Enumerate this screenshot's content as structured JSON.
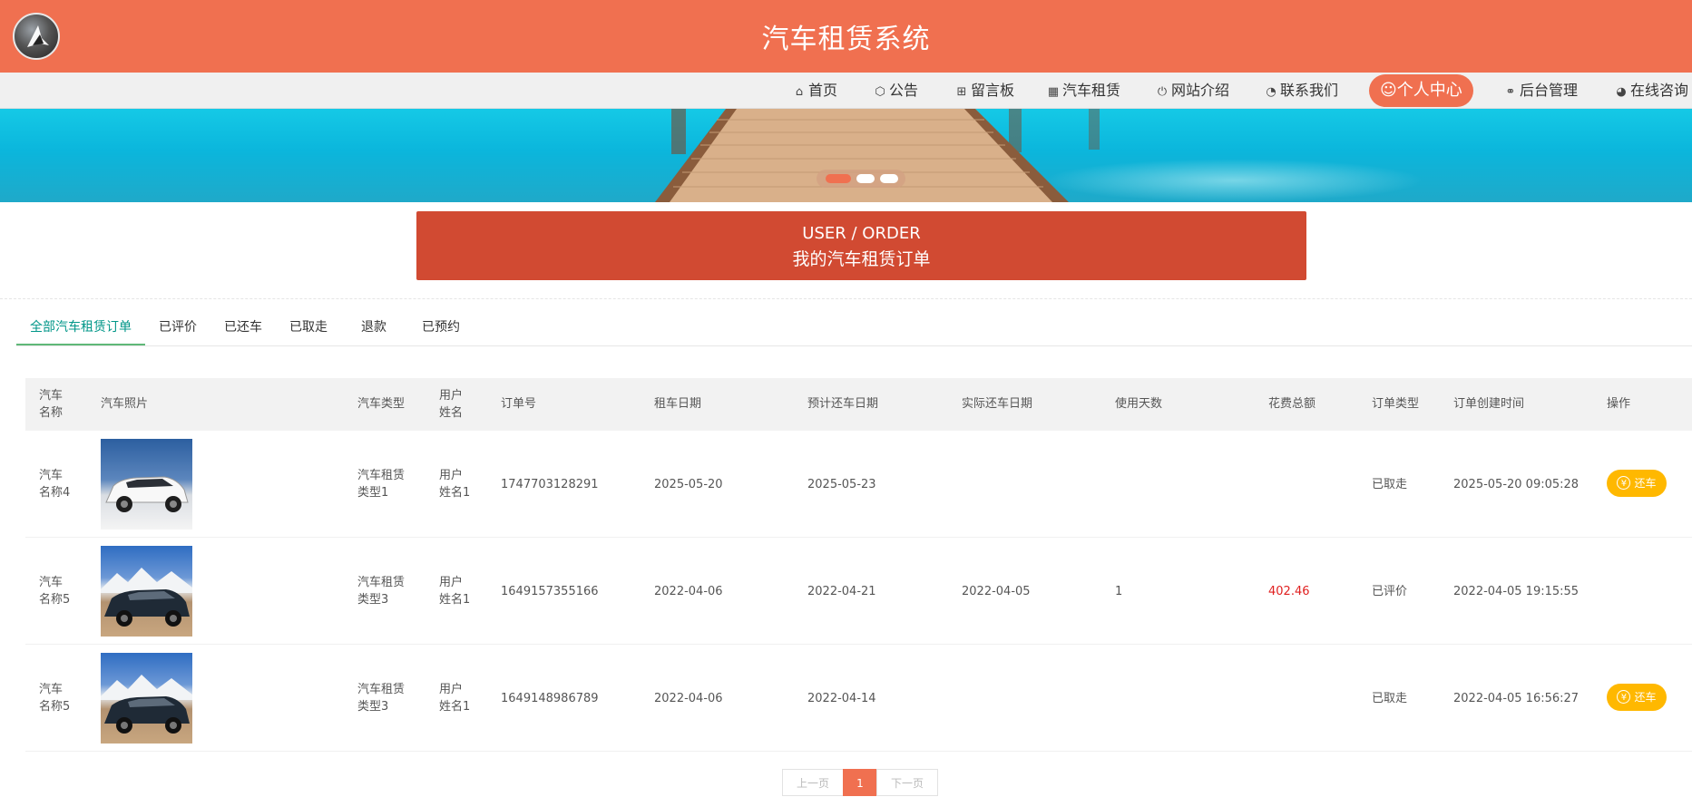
{
  "header": {
    "title": "汽车租赁系统",
    "logo_icon": "shark-logo-icon"
  },
  "nav": {
    "items": [
      {
        "label": "首页",
        "icon": "home-icon",
        "glyph": "⌂"
      },
      {
        "label": "公告",
        "icon": "cube-icon",
        "glyph": "⬡"
      },
      {
        "label": "留言板",
        "icon": "gift-icon",
        "glyph": "⊞"
      },
      {
        "label": "汽车租赁",
        "icon": "calendar-icon",
        "glyph": "▦"
      },
      {
        "label": "网站介绍",
        "icon": "power-icon",
        "glyph": "⏻"
      },
      {
        "label": "联系我们",
        "icon": "palette-icon",
        "glyph": "◔"
      },
      {
        "label": "个人中心",
        "icon": "user-icon",
        "glyph": "☺"
      },
      {
        "label": "后台管理",
        "icon": "link-icon",
        "glyph": "⚭"
      },
      {
        "label": "在线咨询",
        "icon": "chat-icon",
        "glyph": "◕"
      }
    ],
    "active_index": 6
  },
  "banner": {
    "active_slide": 1,
    "slide_count": 3
  },
  "section": {
    "en_title": "USER / ORDER",
    "cn_title": "我的汽车租赁订单"
  },
  "tabs": [
    "全部汽车租赁订单",
    "已评价",
    "已还车",
    "已取走",
    "退款",
    "已预约"
  ],
  "active_tab": 0,
  "table": {
    "headers": {
      "car_name": [
        "汽车",
        "名称"
      ],
      "photo": "汽车照片",
      "car_type": "汽车类型",
      "user_name": [
        "用户",
        "姓名"
      ],
      "order_no": "订单号",
      "rent_date": "租车日期",
      "expected_return": "预计还车日期",
      "actual_return": "实际还车日期",
      "days": "使用天数",
      "total": "花费总额",
      "order_type": "订单类型",
      "created": "订单创建时间",
      "action": "操作"
    },
    "rows": [
      {
        "car_name": [
          "汽车",
          "名称4"
        ],
        "photo": "white-suv",
        "car_type": [
          "汽车租赁",
          "类型1"
        ],
        "user_name": [
          "用户",
          "姓名1"
        ],
        "order_no": "1747703128291",
        "rent_date": "2025-05-20",
        "expected_return": "2025-05-23",
        "actual_return": "",
        "days": "",
        "total": "",
        "order_type": "已取走",
        "created": "2025-05-20 09:05:28",
        "action": "还车"
      },
      {
        "car_name": [
          "汽车",
          "名称5"
        ],
        "photo": "dark-suv",
        "car_type": [
          "汽车租赁",
          "类型3"
        ],
        "user_name": [
          "用户",
          "姓名1"
        ],
        "order_no": "1649157355166",
        "rent_date": "2022-04-06",
        "expected_return": "2022-04-21",
        "actual_return": "2022-04-05",
        "days": "1",
        "total": "402.46",
        "order_type": "已评价",
        "created": "2022-04-05 19:15:55",
        "action": ""
      },
      {
        "car_name": [
          "汽车",
          "名称5"
        ],
        "photo": "dark-suv",
        "car_type": [
          "汽车租赁",
          "类型3"
        ],
        "user_name": [
          "用户",
          "姓名1"
        ],
        "order_no": "1649148986789",
        "rent_date": "2022-04-06",
        "expected_return": "2022-04-14",
        "actual_return": "",
        "days": "",
        "total": "",
        "order_type": "已取走",
        "created": "2022-04-05 16:56:27",
        "action": "还车"
      }
    ],
    "action_icon": "yen-icon",
    "action_glyph": "¥"
  },
  "pagination": {
    "prev": "上一页",
    "current": "1",
    "next": "下一页"
  },
  "colors": {
    "primary": "#f07050",
    "title_bar": "#d14a32",
    "tab_active": "#009688",
    "button": "#ffb800",
    "price": "#e02020"
  }
}
